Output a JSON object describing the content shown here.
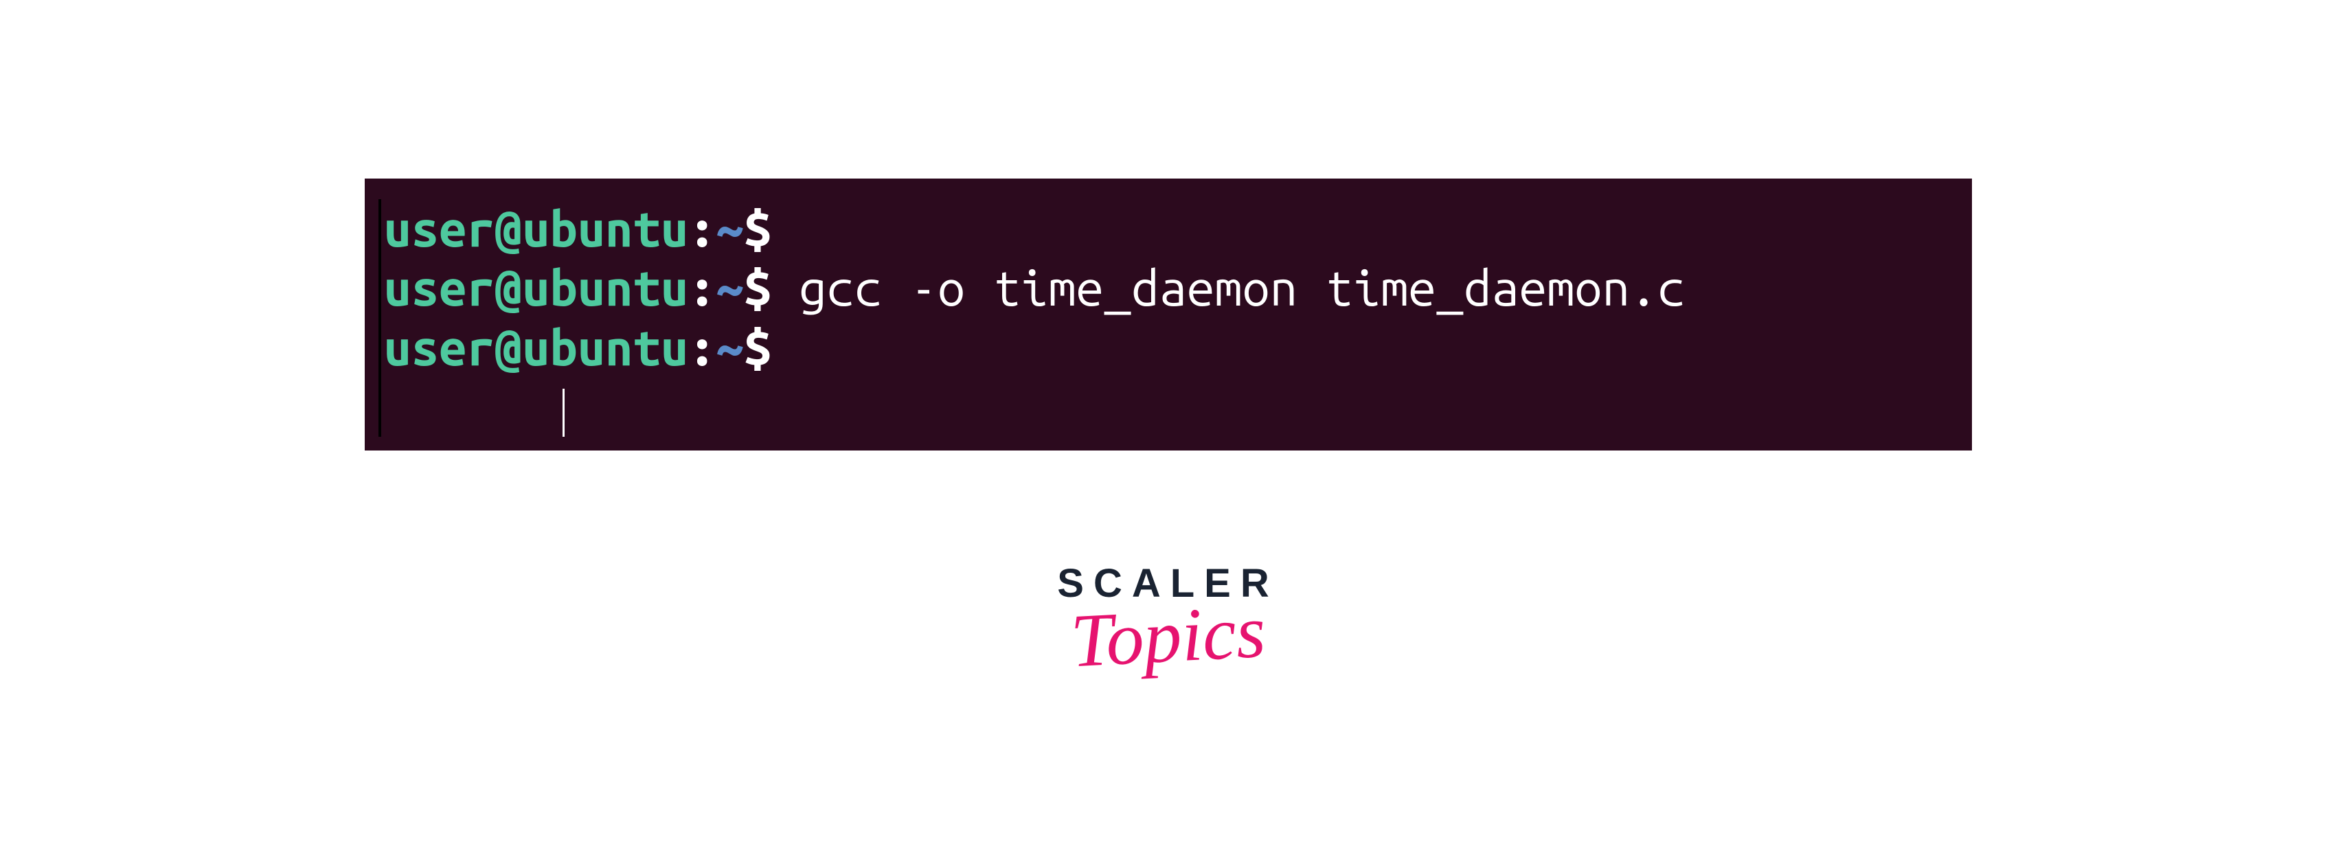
{
  "terminal": {
    "lines": [
      {
        "user": "user@ubuntu",
        "colon": ":",
        "path": "~",
        "dollar": "$",
        "command": ""
      },
      {
        "user": "user@ubuntu",
        "colon": ":",
        "path": "~",
        "dollar": "$",
        "command": " gcc -o time_daemon time_daemon.c"
      },
      {
        "user": "user@ubuntu",
        "colon": ":",
        "path": "~",
        "dollar": "$",
        "command": ""
      }
    ]
  },
  "logo": {
    "line1": "SCALER",
    "line2": "Topics"
  }
}
